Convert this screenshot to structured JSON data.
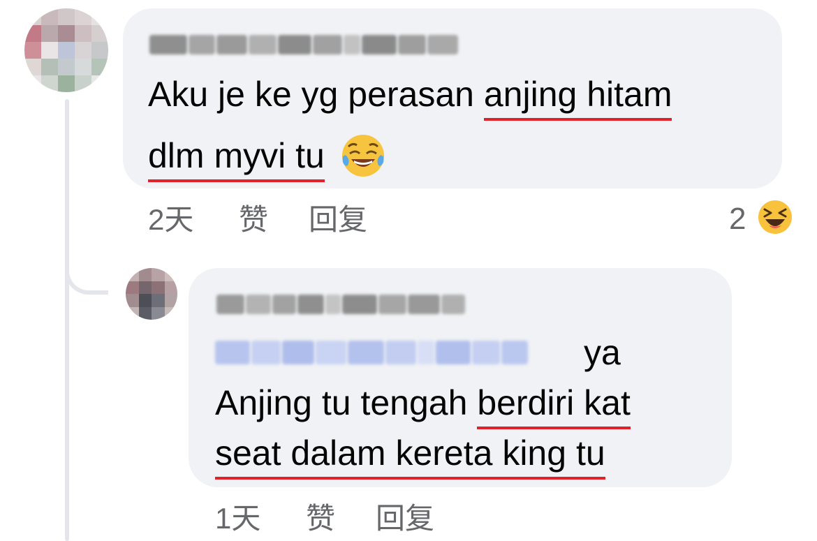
{
  "main_comment": {
    "line1_plain": "Aku je ke yg perasan",
    "line1_underlined": "anjing hitam",
    "line2_underlined": "dlm myvi tu",
    "emoji": "laughing-tears-emoji",
    "time": "2天",
    "like": "赞",
    "reply": "回复",
    "reaction_count": "2",
    "reaction_icon": "grinning-squinting-face-icon"
  },
  "reply_comment": {
    "mention_suffix": "ya",
    "line2_plain": "Anjing tu tengah",
    "line2_underlined": "berdiri kat",
    "line3_underlined": "seat dalam kereta king tu",
    "time": "1天",
    "like": "赞",
    "reply": "回复"
  },
  "colors": {
    "bubble_bg": "#f0f2f5",
    "meta_text": "#65676b",
    "underline": "#e0222a",
    "thread_line": "#e4e6eb"
  }
}
